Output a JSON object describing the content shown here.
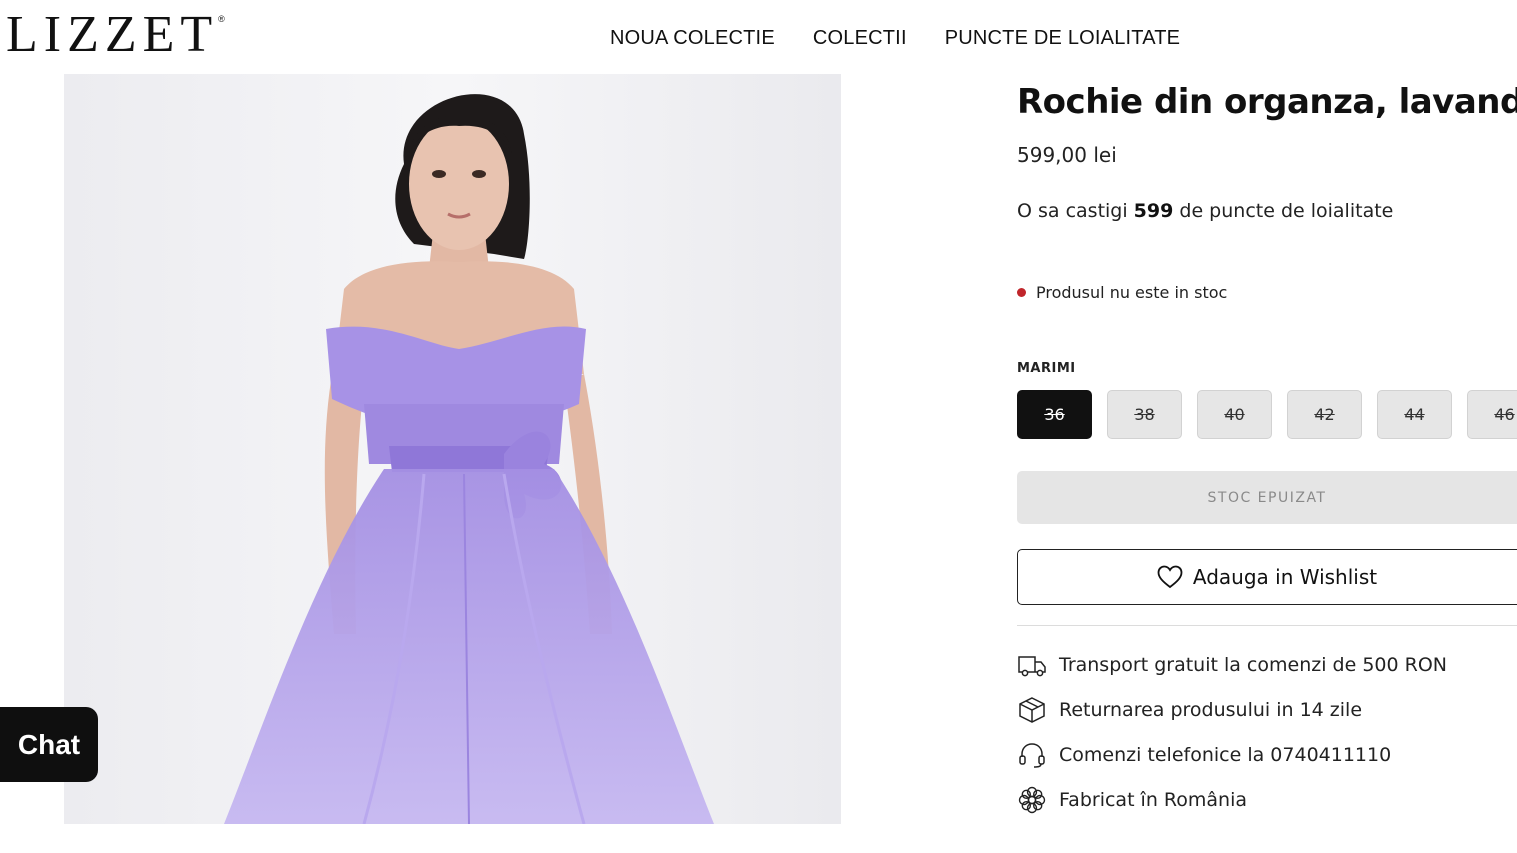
{
  "header": {
    "logo": "LIZZET",
    "logo_mark": "®",
    "nav": [
      "NOUA COLECTIE",
      "COLECTII",
      "PUNCTE DE LOIALITATE"
    ]
  },
  "product": {
    "title": "Rochie din organza, lavanda",
    "price": "599,00 lei",
    "points_prefix": "O sa castigi ",
    "points_value": "599",
    "points_suffix": " de puncte de loialitate",
    "stock_status": "Produsul nu este in stoc",
    "stock_color": "#c0262b",
    "sizes_label": "MARIMI",
    "sizes": [
      "36",
      "38",
      "40",
      "42",
      "44",
      "46"
    ],
    "selected_size": "36",
    "soldout_label": "STOC EPUIZAT",
    "wishlist_label": "Adauga in Wishlist",
    "dress_color": "#a995e6"
  },
  "features": [
    {
      "icon": "truck-icon",
      "text": "Transport gratuit la comenzi de 500 RON"
    },
    {
      "icon": "package-icon",
      "text": "Returnarea produsului in 14 zile"
    },
    {
      "icon": "headset-icon",
      "text": "Comenzi telefonice la 0740411110"
    },
    {
      "icon": "flower-icon",
      "text": "Fabricat în România"
    }
  ],
  "chat": {
    "label": "Chat"
  }
}
